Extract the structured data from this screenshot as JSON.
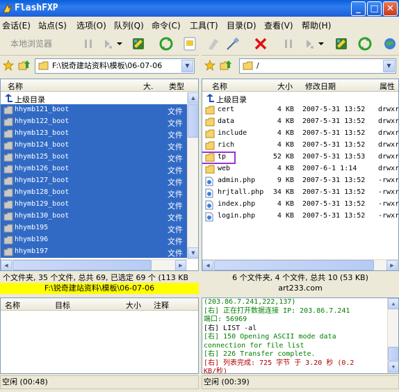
{
  "window": {
    "title": "FlashFXP"
  },
  "menu": [
    "会话(E)",
    "站点(S)",
    "选项(O)",
    "队列(Q)",
    "命令(C)",
    "工具(T)",
    "目录(D)",
    "查看(V)",
    "帮助(H)"
  ],
  "toolbar": {
    "local_browser_label": "本地浏览器"
  },
  "left": {
    "path": "F:\\锐奇建站资料\\模板\\06-07-06",
    "columns": {
      "name": "名称",
      "size": "大.",
      "type": "类型"
    },
    "up_label": "上级目录",
    "rows": [
      {
        "name": "hhymb121_boot",
        "type": "文件"
      },
      {
        "name": "hhymb122_boot",
        "type": "文件"
      },
      {
        "name": "hhymb123_boot",
        "type": "文件"
      },
      {
        "name": "hhymb124_boot",
        "type": "文件"
      },
      {
        "name": "hhymb125_boot",
        "type": "文件"
      },
      {
        "name": "hhymb126_boot",
        "type": "文件"
      },
      {
        "name": "hhymb127_boot",
        "type": "文件"
      },
      {
        "name": "hhymb128_boot",
        "type": "文件"
      },
      {
        "name": "hhymb129_boot",
        "type": "文件"
      },
      {
        "name": "hhymb130_boot",
        "type": "文件"
      },
      {
        "name": "hhymb195",
        "type": "文件"
      },
      {
        "name": "hhymb196",
        "type": "文件"
      },
      {
        "name": "hhymb197",
        "type": "文件"
      }
    ],
    "status": "个文件夹, 35 个文件, 总共 69, 已选定 69 个 (113 KB",
    "path_status": "F:\\锐奇建站资料\\模板\\06-07-06"
  },
  "right": {
    "path": "/",
    "columns": {
      "name": "名称",
      "size": "大小",
      "modified": "修改日期",
      "attr": "属性"
    },
    "up_label": "上级目录",
    "rows": [
      {
        "name": "cert",
        "kind": "folder",
        "size": "4 KB",
        "date": "2007-5-31 13:52",
        "attr": "drwxr"
      },
      {
        "name": "data",
        "kind": "folder",
        "size": "4 KB",
        "date": "2007-5-31 13:52",
        "attr": "drwxr"
      },
      {
        "name": "include",
        "kind": "folder",
        "size": "4 KB",
        "date": "2007-5-31 13:52",
        "attr": "drwxr"
      },
      {
        "name": "rich",
        "kind": "folder",
        "size": "4 KB",
        "date": "2007-5-31 13:52",
        "attr": "drwxr"
      },
      {
        "name": "tp",
        "kind": "folder",
        "size": "52 KB",
        "date": "2007-5-31 13:53",
        "attr": "drwxr"
      },
      {
        "name": "web",
        "kind": "folder",
        "size": "4 KB",
        "date": "2007-6-1 1:14",
        "attr": "drwxr"
      },
      {
        "name": "admin.php",
        "kind": "file",
        "size": "9 KB",
        "date": "2007-5-31 13:52",
        "attr": "-rwxr"
      },
      {
        "name": "hrjtall.php",
        "kind": "file",
        "size": "34 KB",
        "date": "2007-5-31 13:52",
        "attr": "-rwxr"
      },
      {
        "name": "index.php",
        "kind": "file",
        "size": "4 KB",
        "date": "2007-5-31 13:52",
        "attr": "-rwxr"
      },
      {
        "name": "login.php",
        "kind": "file",
        "size": "4 KB",
        "date": "2007-5-31 13:52",
        "attr": "-rwxr"
      }
    ],
    "status": "6 个文件夹, 4 个文件, 总共 10 (53 KB)",
    "server": "art233.com"
  },
  "queue": {
    "columns": {
      "name": "名称",
      "target": "目标",
      "size": "大小",
      "note": "注释"
    }
  },
  "log": [
    {
      "text": "(203.86.7.241,222,137)",
      "color": "green"
    },
    {
      "text": "[右] 正在打开数据连接 IP: 203.86.7.241",
      "color": "green"
    },
    {
      "text": "端口: 56969",
      "color": "green"
    },
    {
      "text": "[右] LIST -al",
      "color": "black"
    },
    {
      "text": "[右] 150 Opening ASCII mode data",
      "color": "green"
    },
    {
      "text": "connection for file list",
      "color": "green"
    },
    {
      "text": "[右] 226 Transfer complete.",
      "color": "green"
    },
    {
      "text": "[右] 列表完成: 725 字节 于 3.20 秒 (0.2",
      "color": "red"
    },
    {
      "text": "KB/秒)",
      "color": "red"
    }
  ],
  "statusbar": {
    "left": "空闲  (00:48)",
    "right": "空闲  (00:39)"
  },
  "colors": {
    "selection": "#316ac5",
    "highlight_box": "#9b30d9",
    "path_status_bg": "#ffff00"
  }
}
